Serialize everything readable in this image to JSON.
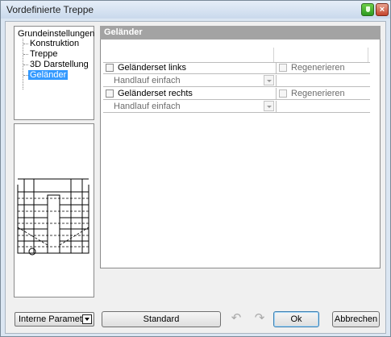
{
  "window": {
    "title": "Vordefinierte Treppe",
    "shield_icon": "shield-icon",
    "close_label": "×"
  },
  "tree": {
    "root": "Grundeinstellungen",
    "items": [
      {
        "label": "Konstruktion",
        "selected": false
      },
      {
        "label": "Treppe",
        "selected": false
      },
      {
        "label": "3D Darstellung",
        "selected": false
      },
      {
        "label": "Geländer",
        "selected": true
      }
    ]
  },
  "panel": {
    "header": "Geländer",
    "rows": [
      {
        "checkbox_label": "Geländerset links",
        "checked": false,
        "regen_label": "Regenerieren",
        "dropdown_value": "Handlauf einfach"
      },
      {
        "checkbox_label": "Geländerset rechts",
        "checked": false,
        "regen_label": "Regenerieren",
        "dropdown_value": "Handlauf einfach"
      }
    ]
  },
  "footer": {
    "param_select": "Interne Parameter",
    "standard_label": "Standard",
    "undo_icon": "undo-icon",
    "redo_icon": "redo-icon",
    "ok_label": "Ok",
    "cancel_label": "Abbrechen"
  },
  "colors": {
    "panel_header_bg": "#a3a3a3",
    "selection": "#3399ff"
  }
}
